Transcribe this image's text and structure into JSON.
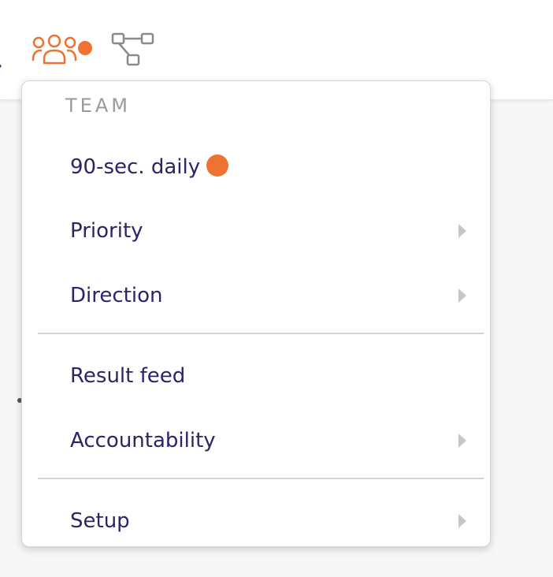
{
  "colors": {
    "accent": "#ee7330",
    "text": "#2c2466",
    "muted": "#9a9a9a",
    "icon_gray": "#8a8a8a"
  },
  "nav": {
    "icons": [
      "person-icon",
      "team-icon",
      "org-chart-icon"
    ],
    "team_has_notification": true
  },
  "menu": {
    "section_title": "TEAM",
    "items": [
      {
        "label": "90-sec. daily",
        "badge": true,
        "submenu": false
      },
      {
        "label": "Priority",
        "badge": false,
        "submenu": true
      },
      {
        "label": "Direction",
        "badge": false,
        "submenu": true
      },
      {
        "label": "Result feed",
        "badge": false,
        "submenu": false
      },
      {
        "label": "Accountability",
        "badge": false,
        "submenu": true
      },
      {
        "label": "Setup",
        "badge": false,
        "submenu": true
      }
    ]
  }
}
